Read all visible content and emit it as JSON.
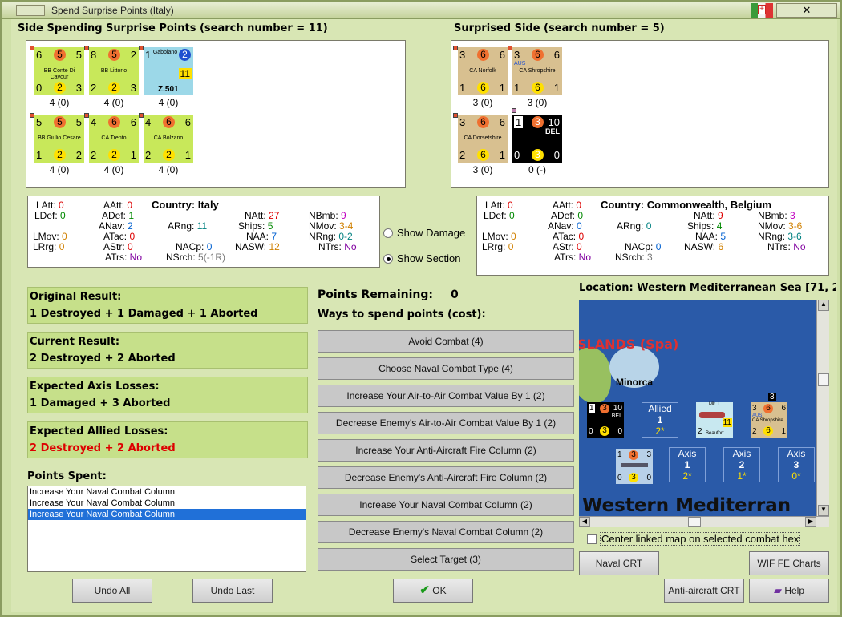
{
  "window": {
    "title": "Spend Surprise Points (Italy)",
    "close_glyph": "✕"
  },
  "left_side": {
    "header": "Side Spending Surprise Points (search number = 11)",
    "units": [
      {
        "tl": "6",
        "dot": "5",
        "tr": "5",
        "name": "BB Conte Di Cavour",
        "bl": "0",
        "yd": "2",
        "br": "3",
        "cap": "4 (0)"
      },
      {
        "tl": "8",
        "dot": "5",
        "tr": "2",
        "name": "BB Littorio",
        "bl": "2",
        "yd": "2",
        "br": "3",
        "cap": "4 (0)"
      },
      {
        "tl": "1",
        "name": "Gabbiano",
        "blue": "2",
        "big": "11",
        "sub": "Z.501",
        "cap": "4 (0)"
      },
      {
        "tl": "5",
        "dot": "5",
        "tr": "5",
        "name": "BB Giulio Cesare",
        "bl": "1",
        "yd": "2",
        "br": "2",
        "cap": "4 (0)"
      },
      {
        "tl": "4",
        "dot": "6",
        "tr": "6",
        "name": "CA Trento",
        "bl": "2",
        "yd": "2",
        "br": "1",
        "cap": "4 (0)"
      },
      {
        "tl": "4",
        "dot": "6",
        "tr": "6",
        "name": "CA Bolzano",
        "bl": "2",
        "yd": "2",
        "br": "1",
        "cap": "4 (0)"
      }
    ],
    "stats": {
      "latt": "0",
      "ldef": "0",
      "lmov": "0",
      "lrng": "0",
      "aatt": "0",
      "adef": "1",
      "anav": "2",
      "atac": "0",
      "astr": "0",
      "atrs": "No",
      "country": "Country: Italy",
      "arng": "11",
      "nacp": "0",
      "nsrch": "5(-1R)",
      "natt": "27",
      "ships": "5",
      "naa": "7",
      "nasw": "12",
      "nbmb": "9",
      "nmov": "3-4",
      "nrng": "0-2",
      "ntrs": "No"
    }
  },
  "right_side": {
    "header": "Surprised Side (search number = 5)",
    "units": [
      {
        "tl": "3",
        "dot": "6",
        "tr": "6",
        "name": "CA Norfolk",
        "bl": "1",
        "yd": "6",
        "br": "1",
        "cap": "3 (0)"
      },
      {
        "tl": "3",
        "dot": "6",
        "tr": "6",
        "name": "CA Shropshire",
        "aus": "AUS",
        "bl": "1",
        "yd": "6",
        "br": "1",
        "cap": "3 (0)"
      },
      {
        "tl": "3",
        "dot": "6",
        "tr": "6",
        "name": "CA Dorsetshire",
        "bl": "2",
        "yd": "6",
        "br": "1",
        "cap": "3 (0)"
      },
      {
        "tl": "1",
        "dot": "3",
        "tr": "10",
        "name": "BEL",
        "bl": "0",
        "yd": "3",
        "br": "0",
        "cap": "0 (-)"
      }
    ],
    "stats": {
      "latt": "0",
      "ldef": "0",
      "lmov": "0",
      "lrng": "0",
      "aatt": "0",
      "adef": "0",
      "anav": "0",
      "atac": "0",
      "astr": "0",
      "atrs": "No",
      "country": "Country: Commonwealth, Belgium",
      "arng": "0",
      "nacp": "0",
      "nsrch": "3",
      "natt": "9",
      "ships": "4",
      "naa": "5",
      "nasw": "6",
      "nbmb": "3",
      "nmov": "3-6",
      "nrng": "3-6",
      "ntrs": "No"
    }
  },
  "labels": {
    "latt": "LAtt:",
    "ldef": "LDef:",
    "lmov": "LMov:",
    "lrng": "LRrg:",
    "aatt": "AAtt:",
    "adef": "ADef:",
    "anav": "ANav:",
    "atac": "ATac:",
    "astr": "AStr:",
    "atrs": "ATrs:",
    "arng": "ARng:",
    "nacp": "NACp:",
    "nsrch": "NSrch:",
    "natt": "NAtt:",
    "ships": "Ships:",
    "naa": "NAA:",
    "nasw": "NASW:",
    "nbmb": "NBmb:",
    "nmov": "NMov:",
    "nrng": "NRng:",
    "ntrs": "NTrs:"
  },
  "options": {
    "show_damage": "Show Damage",
    "show_section": "Show Section"
  },
  "results": {
    "original": {
      "label": "Original Result:",
      "value": "1 Destroyed + 1 Damaged + 1 Aborted"
    },
    "current": {
      "label": "Current Result:",
      "value": "2 Destroyed + 2 Aborted"
    },
    "axis": {
      "label": "Expected Axis Losses:",
      "value": "1 Damaged + 3 Aborted"
    },
    "allied": {
      "label": "Expected Allied Losses:",
      "value": "2 Destroyed + 2 Aborted"
    }
  },
  "points_spent": {
    "label": "Points Spent:",
    "items": [
      "Increase Your Naval Combat Column",
      "Increase Your Naval Combat Column",
      "Increase Your Naval Combat Column"
    ]
  },
  "points": {
    "remaining_label": "Points Remaining:",
    "remaining_value": "0",
    "ways_label": "Ways to spend points (cost):"
  },
  "spend_buttons": [
    "Avoid Combat (4)",
    "Choose Naval Combat Type (4)",
    "Increase Your Air-to-Air Combat Value By 1 (2)",
    "Decrease Enemy's Air-to-Air Combat Value By 1 (2)",
    "Increase Your Anti-Aircraft Fire Column (2)",
    "Decrease Enemy's Anti-Aircraft Fire Column (2)",
    "Increase Your Naval Combat Column (2)",
    "Decrease Enemy's Naval Combat Column (2)",
    "Select Target (3)"
  ],
  "map": {
    "location": "Location: Western Mediterranean Sea [71, 2",
    "islands": "SLANDS (Spa)",
    "minorca": "Minorca",
    "sea": "Western Mediterran",
    "allied": {
      "label": "Allied",
      "n": "1",
      "v": "2*"
    },
    "axis": [
      {
        "label": "Axis",
        "n": "1",
        "v": "2*"
      },
      {
        "label": "Axis",
        "n": "2",
        "v": "1*"
      },
      {
        "label": "Axis",
        "n": "3",
        "v": "0*"
      }
    ],
    "stack": "3",
    "beaufort": "Beaufort",
    "mk": "Mk. I",
    "shrop": "CA Shropshire",
    "aus": "AUS",
    "bel": "BEL",
    "bel_unit": {
      "tl": "1",
      "dot": "3",
      "tr": "10",
      "bl": "0",
      "yd": "3",
      "br": "0"
    },
    "beau_unit": {
      "tl": "2",
      "big": "11"
    },
    "shrop_unit": {
      "tl": "3",
      "dot": "6",
      "tr": "6",
      "bl": "2",
      "yd": "6",
      "br": "1"
    },
    "ital_unit": {
      "tl": "1",
      "dot": "3",
      "tr": "3",
      "bl": "0",
      "yd": "3",
      "br": "0"
    },
    "center_label": "Center linked map on selected combat hex"
  },
  "buttons": {
    "undo_all": "Undo All",
    "undo_last": "Undo Last",
    "ok": "OK",
    "naval_crt": "Naval CRT",
    "wif_charts": "WIF FE Charts",
    "aa_crt": "Anti-aircraft CRT",
    "help": "Help"
  },
  "colors": {
    "unit_italy": "#c8e85a",
    "unit_cw": "#d8c090",
    "red_text": "#dd0000",
    "sea": "#2a5aa8"
  }
}
